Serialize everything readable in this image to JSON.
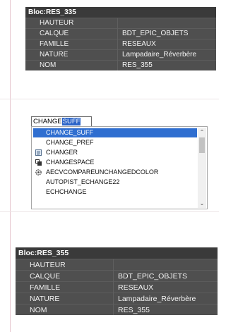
{
  "top_panel": {
    "title": "Bloc:RES_335",
    "rows": [
      {
        "key": "HAUTEUR",
        "value": ""
      },
      {
        "key": "CALQUE",
        "value": "BDT_EPIC_OBJETS"
      },
      {
        "key": "FAMILLE",
        "value": "RESEAUX"
      },
      {
        "key": "NATURE",
        "value": "Lampadaire_Réverbère"
      },
      {
        "key": "NOM",
        "value": "RES_355"
      }
    ]
  },
  "command_line": {
    "typed": "CHANGE",
    "suggestion": "SUFF"
  },
  "autocomplete": {
    "items": [
      {
        "label": "CHANGE_SUFF",
        "icon": "none",
        "selected": true
      },
      {
        "label": "CHANGE_PREF",
        "icon": "none",
        "selected": false
      },
      {
        "label": "CHANGER",
        "icon": "properties-icon",
        "selected": false
      },
      {
        "label": "CHANGESPACE",
        "icon": "changespace-icon",
        "selected": false
      },
      {
        "label": "AECVCOMPAREUNCHANGEDCOLOR",
        "icon": "gear-icon",
        "selected": false
      },
      {
        "label": "AUTOPIST_ECHANGE22",
        "icon": "none",
        "selected": false
      },
      {
        "label": "ECHCHANGE",
        "icon": "none",
        "selected": false
      }
    ],
    "scroll_up": "⌃",
    "scroll_down": "⌄"
  },
  "bottom_panel": {
    "title": "Bloc:RES_355",
    "rows": [
      {
        "key": "HAUTEUR",
        "value": ""
      },
      {
        "key": "CALQUE",
        "value": "BDT_EPIC_OBJETS"
      },
      {
        "key": "FAMILLE",
        "value": "RESEAUX"
      },
      {
        "key": "NATURE",
        "value": "Lampadaire_Réverbère"
      },
      {
        "key": "NOM",
        "value": "RES_355"
      }
    ]
  },
  "colors": {
    "panel_bg": "#4f4f4f",
    "panel_header": "#3a3a3a",
    "selection": "#2f6ed0",
    "guide": "#e6c8cf"
  }
}
